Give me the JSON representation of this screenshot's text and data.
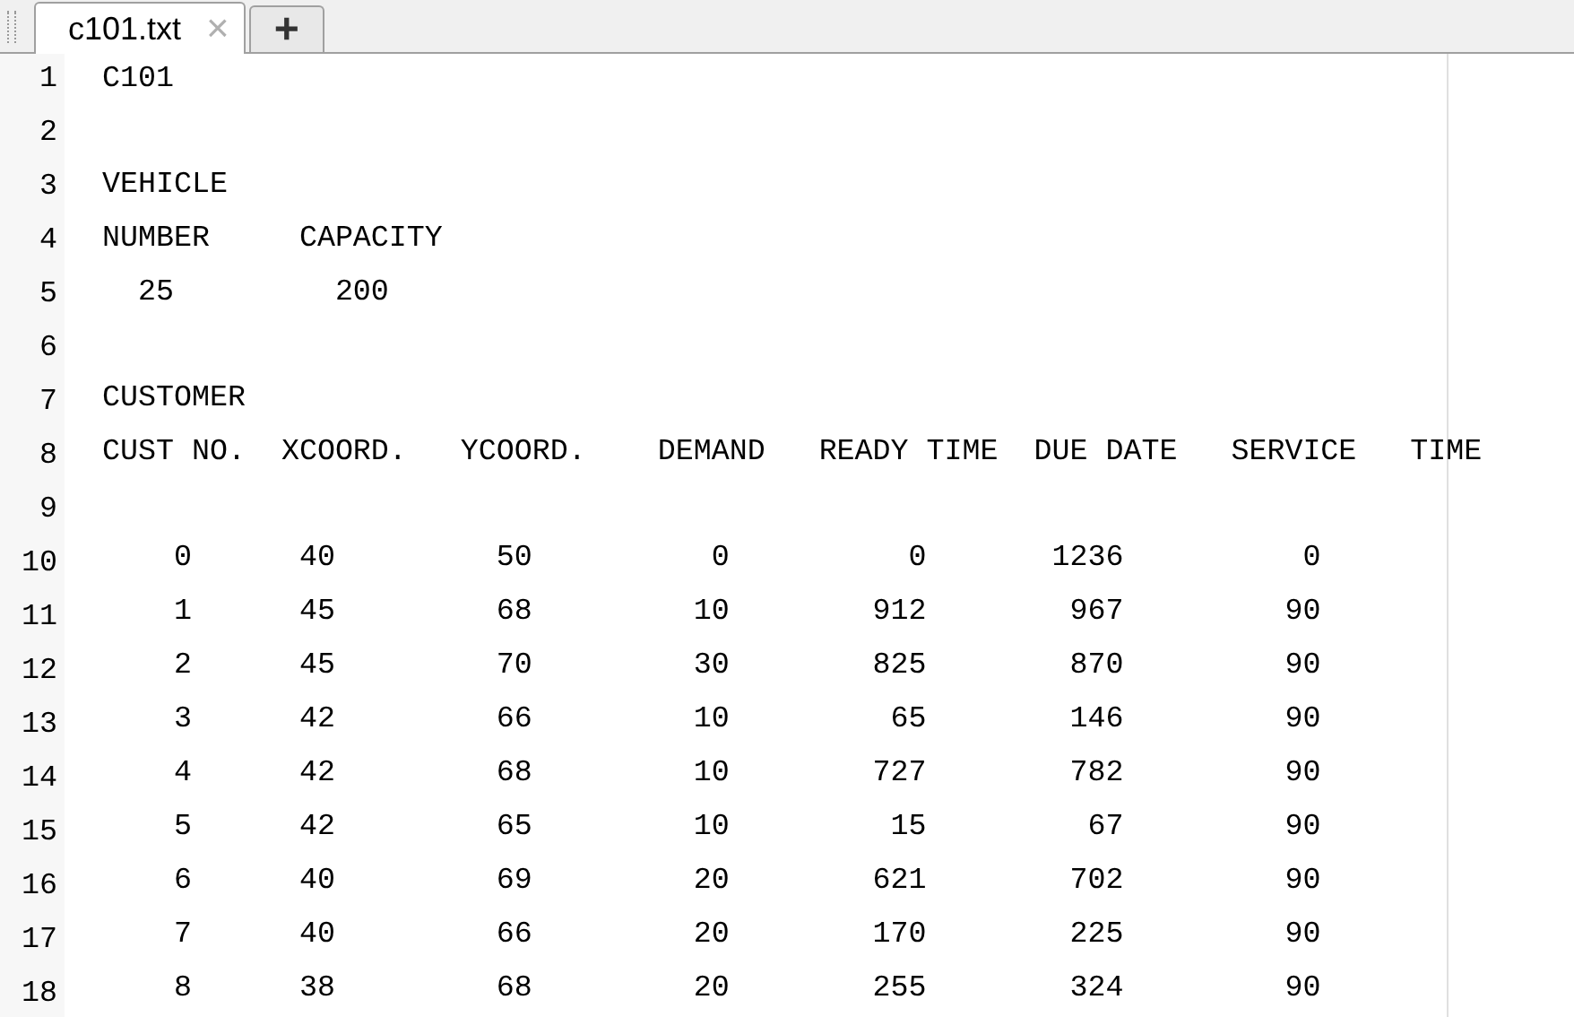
{
  "tabs": [
    {
      "label": "c101.txt",
      "close": "×",
      "selected": true
    }
  ],
  "new_tab": "+",
  "lines": [
    {
      "number": "1",
      "kind": "text",
      "text": "C101"
    },
    {
      "number": "2",
      "kind": "blank"
    },
    {
      "number": "3",
      "kind": "text",
      "text": "VEHICLE"
    },
    {
      "number": "4",
      "kind": "text",
      "text": "NUMBER     CAPACITY"
    },
    {
      "number": "5",
      "kind": "text",
      "text": "  25         200"
    },
    {
      "number": "6",
      "kind": "blank"
    },
    {
      "number": "7",
      "kind": "text",
      "text": "CUSTOMER"
    },
    {
      "number": "8",
      "kind": "text",
      "text": "CUST NO.  XCOORD.   YCOORD.    DEMAND   READY TIME  DUE DATE   SERVICE   TIME"
    },
    {
      "number": "9",
      "kind": "blank"
    },
    {
      "number": "10",
      "kind": "row",
      "cells": [
        "0",
        "40",
        "50",
        "0",
        "0",
        "1236",
        "0"
      ]
    },
    {
      "number": "11",
      "kind": "row",
      "cells": [
        "1",
        "45",
        "68",
        "10",
        "912",
        "967",
        "90"
      ]
    },
    {
      "number": "12",
      "kind": "row",
      "cells": [
        "2",
        "45",
        "70",
        "30",
        "825",
        "870",
        "90"
      ]
    },
    {
      "number": "13",
      "kind": "row",
      "cells": [
        "3",
        "42",
        "66",
        "10",
        "65",
        "146",
        "90"
      ]
    },
    {
      "number": "14",
      "kind": "row",
      "cells": [
        "4",
        "42",
        "68",
        "10",
        "727",
        "782",
        "90"
      ]
    },
    {
      "number": "15",
      "kind": "row",
      "cells": [
        "5",
        "42",
        "65",
        "10",
        "15",
        "67",
        "90"
      ]
    },
    {
      "number": "16",
      "kind": "row",
      "cells": [
        "6",
        "40",
        "69",
        "20",
        "621",
        "702",
        "90"
      ]
    },
    {
      "number": "17",
      "kind": "row",
      "cells": [
        "7",
        "40",
        "66",
        "20",
        "170",
        "225",
        "90"
      ]
    },
    {
      "number": "18",
      "kind": "row",
      "cells": [
        "8",
        "38",
        "68",
        "20",
        "255",
        "324",
        "90"
      ]
    }
  ]
}
